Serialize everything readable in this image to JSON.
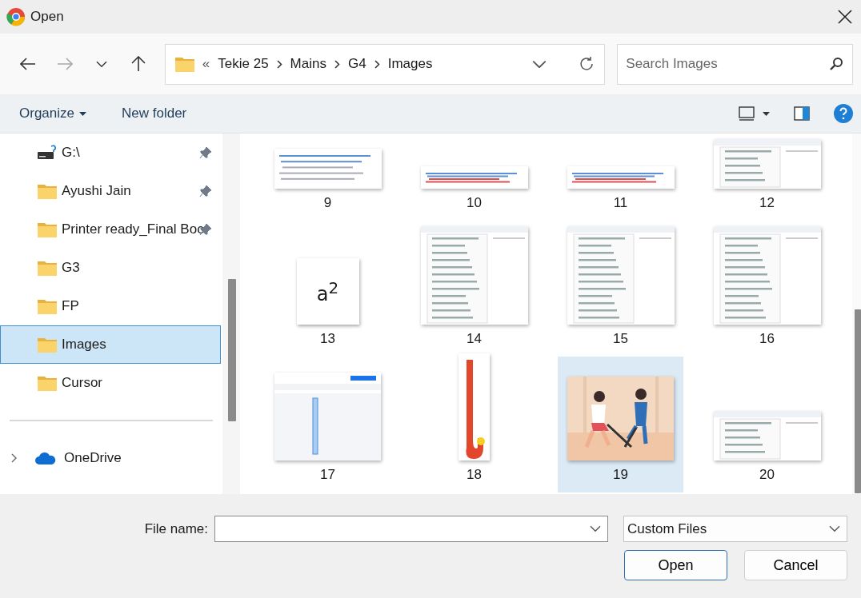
{
  "window": {
    "title": "Open"
  },
  "nav_buttons": [
    {
      "kind": "back",
      "disabled": false
    },
    {
      "kind": "forward",
      "disabled": true
    },
    {
      "kind": "recent",
      "disabled": false
    },
    {
      "kind": "up",
      "disabled": false
    }
  ],
  "address": {
    "overflow": "«",
    "crumbs": [
      "Tekie 25",
      "Mains",
      "G4",
      "Images"
    ]
  },
  "search": {
    "placeholder": "Search Images"
  },
  "toolbar": {
    "organize": "Organize",
    "new_folder": "New folder"
  },
  "sidebar": {
    "items": [
      {
        "label": "G:\\",
        "kind": "drive",
        "pinned": true,
        "selected": false
      },
      {
        "label": "Ayushi Jain",
        "kind": "folder",
        "pinned": true,
        "selected": false
      },
      {
        "label": "Printer ready_Final Boc",
        "kind": "folder",
        "pinned": true,
        "selected": false
      },
      {
        "label": "G3",
        "kind": "folder",
        "pinned": false,
        "selected": false
      },
      {
        "label": "FP",
        "kind": "folder",
        "pinned": false,
        "selected": false
      },
      {
        "label": "Images",
        "kind": "folder",
        "pinned": false,
        "selected": true
      },
      {
        "label": "Cursor",
        "kind": "folder",
        "pinned": false,
        "selected": false
      }
    ],
    "locations": [
      {
        "label": "OneDrive",
        "kind": "cloud",
        "expanded": false
      }
    ]
  },
  "files": [
    {
      "label": "9",
      "kind": "doc",
      "selected": false
    },
    {
      "label": "10",
      "kind": "strip",
      "selected": false
    },
    {
      "label": "11",
      "kind": "strip",
      "selected": false
    },
    {
      "label": "12",
      "kind": "menu-short",
      "selected": false
    },
    {
      "label": "13",
      "kind": "formula",
      "text": "a$^{2}$",
      "selected": false
    },
    {
      "label": "14",
      "kind": "menu",
      "selected": false
    },
    {
      "label": "15",
      "kind": "menu",
      "selected": false
    },
    {
      "label": "16",
      "kind": "menu",
      "selected": false
    },
    {
      "label": "17",
      "kind": "canvas",
      "selected": false
    },
    {
      "label": "18",
      "kind": "stick",
      "selected": false
    },
    {
      "label": "19",
      "kind": "picture",
      "selected": true
    },
    {
      "label": "20",
      "kind": "menu-short",
      "selected": false
    }
  ],
  "footer": {
    "file_name_label": "File name:",
    "filter": "Custom Files",
    "buttons": [
      {
        "label": "Open",
        "default": true
      },
      {
        "label": "Cancel",
        "default": false
      }
    ]
  }
}
